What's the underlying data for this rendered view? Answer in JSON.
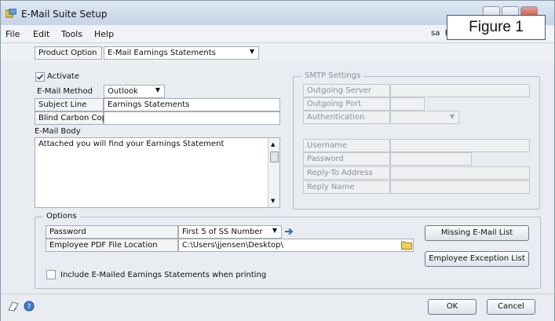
{
  "window": {
    "title": "E-Mail Suite Setup",
    "user": "sa",
    "user_partial": "F"
  },
  "figure_label": "Figure 1",
  "menu": [
    "File",
    "Edit",
    "Tools",
    "Help"
  ],
  "product_option": {
    "label": "Product Option",
    "value": "E-Mail Earnings Statements"
  },
  "activate": {
    "label": "Activate",
    "checked": true
  },
  "email_method": {
    "label": "E-Mail Method",
    "value": "Outlook"
  },
  "subject_line": {
    "label": "Subject Line",
    "value": "Earnings Statements"
  },
  "bcc": {
    "label": "Blind Carbon Copy",
    "value": ""
  },
  "email_body": {
    "label": "E-Mail Body",
    "value": "Attached you will find your Earnings Statement"
  },
  "smtp": {
    "title": "SMTP Settings",
    "outgoing_server": "Outgoing Server",
    "outgoing_port": "Outgoing Port",
    "authentication": "Authentication",
    "username": "Username",
    "password": "Password",
    "reply_to": "Reply-To Address",
    "reply_name": "Reply Name"
  },
  "options": {
    "title": "Options",
    "password_label": "Password",
    "password_value": "First 5 of SS Number",
    "pdf_label": "Employee PDF File Location",
    "pdf_value": "C:\\Users\\jjensen\\Desktop\\",
    "include_label": "Include E-Mailed Earnings Statements when printing",
    "include_checked": false
  },
  "buttons": {
    "missing": "Missing E-Mail List",
    "exception": "Employee Exception List",
    "ok": "OK",
    "cancel": "Cancel"
  }
}
